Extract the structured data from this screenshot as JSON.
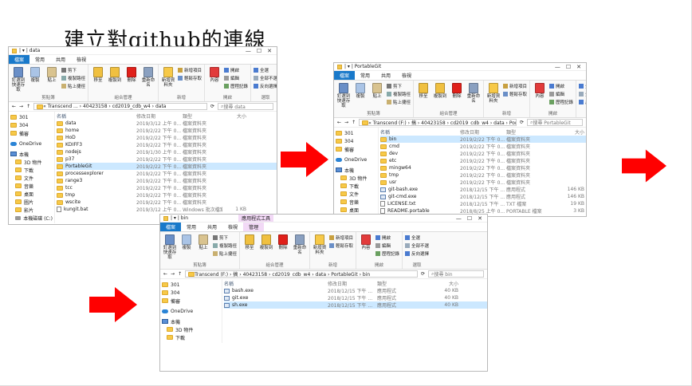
{
  "title": {
    "prefix": "建立對",
    "github": "github",
    "suffix": "的連線"
  },
  "common": {
    "tabs": [
      "檔案",
      "常用",
      "共用",
      "檢視"
    ],
    "manage_tab": "管理",
    "context_tab": "應用程式工具",
    "groups": [
      "剪貼簿",
      "組合管理",
      "新增",
      "開啟",
      "選取"
    ],
    "clip": {
      "pin": "釘選到快速存取",
      "copy": "複製",
      "paste": "貼上",
      "cut": "剪下",
      "copypath": "複製路徑",
      "shortcut": "貼上捷徑"
    },
    "org": {
      "move": "移至",
      "copyto": "複製到",
      "delete": "刪除",
      "rename": "重新命名"
    },
    "new": {
      "folder": "新增資料夾",
      "item": "新增項目",
      "easy": "輕鬆存取"
    },
    "open": {
      "props": "內容",
      "open": "開啟",
      "edit": "編輯",
      "history": "歷程記錄"
    },
    "select": {
      "all": "全選",
      "none": "全部不選",
      "invert": "反向選擇"
    },
    "cols": [
      "名稱",
      "修改日期",
      "類型",
      "大小"
    ],
    "ctrls": [
      "—",
      "☐",
      "✕"
    ]
  },
  "win1": {
    "title": "data",
    "path": "« Transcend ... › 40423158 › cd2019_cdb_w4 › data",
    "search": "搜尋 data",
    "nav": [
      {
        "label": "301",
        "kind": "folder"
      },
      {
        "label": "304",
        "kind": "folder"
      },
      {
        "label": "備審",
        "kind": "folder"
      },
      {
        "label": "OneDrive",
        "kind": "cloud"
      },
      {
        "label": "本機",
        "kind": "pc"
      },
      {
        "label": "3D 物件",
        "kind": "folder"
      },
      {
        "label": "下載",
        "kind": "folder"
      },
      {
        "label": "文件",
        "kind": "folder"
      },
      {
        "label": "音樂",
        "kind": "folder"
      },
      {
        "label": "桌面",
        "kind": "folder"
      },
      {
        "label": "圖片",
        "kind": "folder"
      },
      {
        "label": "影片",
        "kind": "folder"
      },
      {
        "label": "本機磁碟 (C:)",
        "kind": "disk"
      }
    ],
    "rows": [
      {
        "name": "data",
        "date": "2019/3/12 上午 0...",
        "type": "檔案資料夾",
        "size": "",
        "kind": "folder"
      },
      {
        "name": "home",
        "date": "2019/2/22 下午 0...",
        "type": "檔案資料夾",
        "size": "",
        "kind": "folder"
      },
      {
        "name": "HoD",
        "date": "2019/2/22 下午 0...",
        "type": "檔案資料夾",
        "size": "",
        "kind": "folder"
      },
      {
        "name": "KDIFF3",
        "date": "2019/2/22 下午 0...",
        "type": "檔案資料夾",
        "size": "",
        "kind": "folder"
      },
      {
        "name": "nodejs",
        "date": "2019/1/30 上午 0...",
        "type": "檔案資料夾",
        "size": "",
        "kind": "folder"
      },
      {
        "name": "p37",
        "date": "2019/2/22 下午 0...",
        "type": "檔案資料夾",
        "size": "",
        "kind": "folder"
      },
      {
        "name": "PortableGit",
        "date": "2019/2/22 下午 0...",
        "type": "檔案資料夾",
        "size": "",
        "kind": "folder",
        "selected": true
      },
      {
        "name": "processexplorer",
        "date": "2019/2/22 下午 0...",
        "type": "檔案資料夾",
        "size": "",
        "kind": "folder"
      },
      {
        "name": "range3",
        "date": "2019/2/22 下午 0...",
        "type": "檔案資料夾",
        "size": "",
        "kind": "folder"
      },
      {
        "name": "tcc",
        "date": "2019/2/22 下午 0...",
        "type": "檔案資料夾",
        "size": "",
        "kind": "folder"
      },
      {
        "name": "tmp",
        "date": "2019/2/22 下午 0...",
        "type": "檔案資料夾",
        "size": "",
        "kind": "folder"
      },
      {
        "name": "wscite",
        "date": "2019/2/22 下午 0...",
        "type": "檔案資料夾",
        "size": "",
        "kind": "folder"
      },
      {
        "name": "kungit.bat",
        "date": "2019/3/12 上午 0...",
        "type": "Windows 批次檔案",
        "size": "1 KB",
        "kind": "file"
      }
    ]
  },
  "win2": {
    "title": "PortableGit",
    "path": "« Transcend (F:) › 搞 › 40423158 › cd2019_cdb_w4 › data › PortableGit",
    "search": "搜尋 PortableGit",
    "nav": [
      {
        "label": "301",
        "kind": "folder"
      },
      {
        "label": "304",
        "kind": "folder"
      },
      {
        "label": "備審",
        "kind": "folder"
      },
      {
        "label": "OneDrive",
        "kind": "cloud"
      },
      {
        "label": "本機",
        "kind": "pc"
      },
      {
        "label": "3D 物件",
        "kind": "folder"
      },
      {
        "label": "下載",
        "kind": "folder"
      },
      {
        "label": "文件",
        "kind": "folder"
      },
      {
        "label": "音樂",
        "kind": "folder"
      },
      {
        "label": "桌面",
        "kind": "folder"
      }
    ],
    "rows": [
      {
        "name": "bin",
        "date": "2019/2/22 下午 0...",
        "type": "檔案資料夾",
        "size": "",
        "kind": "folder",
        "selected": true
      },
      {
        "name": "cmd",
        "date": "2019/2/22 下午 0...",
        "type": "檔案資料夾",
        "size": "",
        "kind": "folder"
      },
      {
        "name": "dev",
        "date": "2019/2/22 下午 0...",
        "type": "檔案資料夾",
        "size": "",
        "kind": "folder"
      },
      {
        "name": "etc",
        "date": "2019/2/22 下午 0...",
        "type": "檔案資料夾",
        "size": "",
        "kind": "folder"
      },
      {
        "name": "mingw64",
        "date": "2019/2/22 下午 0...",
        "type": "檔案資料夾",
        "size": "",
        "kind": "folder"
      },
      {
        "name": "tmp",
        "date": "2019/2/22 下午 0...",
        "type": "檔案資料夾",
        "size": "",
        "kind": "folder"
      },
      {
        "name": "usr",
        "date": "2019/2/22 下午 0...",
        "type": "檔案資料夾",
        "size": "",
        "kind": "folder"
      },
      {
        "name": "git-bash.exe",
        "date": "2018/12/15 下午 ...",
        "type": "應用程式",
        "size": "146 KB",
        "kind": "exe"
      },
      {
        "name": "git-cmd.exe",
        "date": "2018/12/15 下午 ...",
        "type": "應用程式",
        "size": "146 KB",
        "kind": "exe"
      },
      {
        "name": "LICENSE.txt",
        "date": "2018/12/15 下午 ...",
        "type": "TXT 檔案",
        "size": "19 KB",
        "kind": "file"
      },
      {
        "name": "README.portable",
        "date": "2018/8/25 上午 0...",
        "type": "PORTABLE 檔案",
        "size": "3 KB",
        "kind": "file"
      }
    ]
  },
  "win3": {
    "title": "bin",
    "path": "Transcend (F:) › 搞 › 40423158 › cd2019_cdb_w4 › data › PortableGit › bin",
    "search": "搜尋 bin",
    "nav": [
      {
        "label": "301",
        "kind": "folder"
      },
      {
        "label": "304",
        "kind": "folder"
      },
      {
        "label": "備審",
        "kind": "folder"
      },
      {
        "label": "OneDrive",
        "kind": "cloud"
      },
      {
        "label": "本機",
        "kind": "pc"
      },
      {
        "label": "3D 物件",
        "kind": "folder"
      },
      {
        "label": "下載",
        "kind": "folder"
      }
    ],
    "rows": [
      {
        "name": "bash.exe",
        "date": "2018/12/15 下午 ...",
        "type": "應用程式",
        "size": "40 KB",
        "kind": "exe"
      },
      {
        "name": "git.exe",
        "date": "2018/12/15 下午 ...",
        "type": "應用程式",
        "size": "40 KB",
        "kind": "exe"
      },
      {
        "name": "sh.exe",
        "date": "2018/12/15 下午 ...",
        "type": "應用程式",
        "size": "40 KB",
        "kind": "exe",
        "selected": true
      }
    ]
  },
  "colors": {
    "arrow": "#ff0000",
    "file_tab": "#1979ca",
    "selection": "#cce8ff",
    "manage_tab": "#f2d9f6"
  }
}
